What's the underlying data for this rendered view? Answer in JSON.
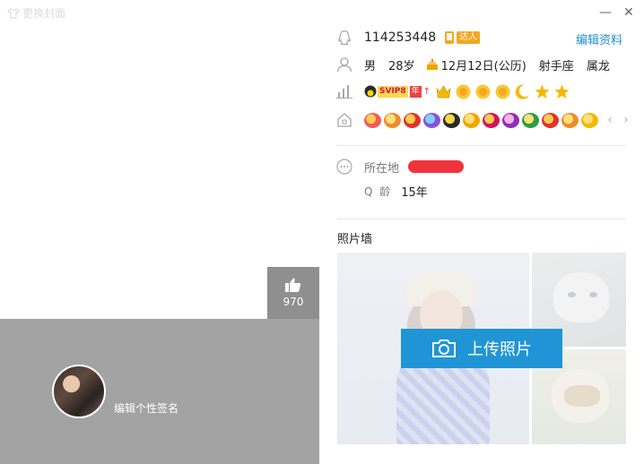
{
  "window": {
    "skin_label": "更换封面",
    "minimize_glyph": "—",
    "close_glyph": "✕"
  },
  "likes": {
    "count": "970",
    "icon": "thumbs-up-icon"
  },
  "cover": {
    "signature": "编辑个性签名",
    "background": "#a3a3a3"
  },
  "profile": {
    "qq_number": "114253448",
    "daren_badge": "达人",
    "edit_label": "编辑资料",
    "gender": "男",
    "age": "28岁",
    "birthday": "12月12日(公历)",
    "constellation": "射手座",
    "zodiac": "属龙",
    "vip_label": "SVIP8",
    "vip_year": "年",
    "location_label": "所在地",
    "qage_label": "Q 龄",
    "qage_value": "15年"
  },
  "photo_wall": {
    "title": "照片墙",
    "upload_label": "上传照片"
  },
  "colors": {
    "accent": "#1f95d6",
    "link": "#1e8fd4",
    "redaction": "#f0333c",
    "vip_gold": "#f0a500"
  }
}
